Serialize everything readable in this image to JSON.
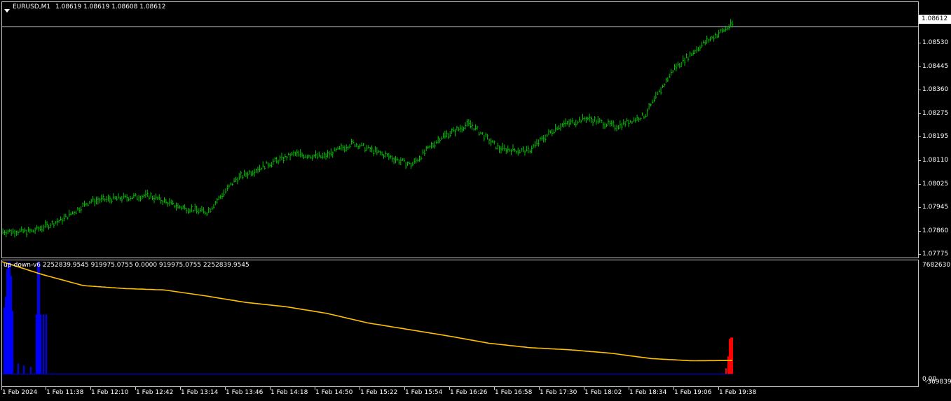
{
  "header": {
    "symbol_label": "EURUSD,M1",
    "ohlc_text": "1.08619 1.08619 1.08608 1.08612",
    "dropdown_icon": "triangle-down-icon"
  },
  "indicator": {
    "label": "up-down-v6 2252839.9545 919975.0755 0.0000 919975.0755 2252839.9545",
    "top_value": "7682630.4",
    "bottom_value": "0.00",
    "bottom_value2": "-369839.5"
  },
  "price_axis": {
    "ticks": [
      "1.08530",
      "1.08445",
      "1.08360",
      "1.08275",
      "1.08195",
      "1.08110",
      "1.08025",
      "1.07945",
      "1.07860",
      "1.07775"
    ],
    "current": "1.08612"
  },
  "time_axis": [
    "1 Feb 2024",
    "1 Feb 11:38",
    "1 Feb 12:10",
    "1 Feb 12:42",
    "1 Feb 13:14",
    "1 Feb 13:46",
    "1 Feb 14:18",
    "1 Feb 14:50",
    "1 Feb 15:22",
    "1 Feb 15:54",
    "1 Feb 16:26",
    "1 Feb 16:58",
    "1 Feb 17:30",
    "1 Feb 18:02",
    "1 Feb 18:34",
    "1 Feb 19:06",
    "1 Feb 19:38"
  ],
  "colors": {
    "bars": "#00c000",
    "yellow_line": "#ffc000",
    "up_hist": "#0000ff",
    "down_hist": "#ff0000",
    "grid": "#c8c8c8",
    "background": "#000000"
  },
  "chart_data": [
    {
      "type": "line",
      "title": "EURUSD,M1",
      "ylim": [
        1.07775,
        1.0865
      ],
      "x": [
        "1 Feb 2024",
        "1 Feb 11:38",
        "1 Feb 12:10",
        "1 Feb 12:42",
        "1 Feb 13:14",
        "1 Feb 13:46",
        "1 Feb 14:18",
        "1 Feb 14:50",
        "1 Feb 15:22",
        "1 Feb 15:54",
        "1 Feb 16:26",
        "1 Feb 16:58",
        "1 Feb 17:30",
        "1 Feb 18:02",
        "1 Feb 18:34",
        "1 Feb 19:06",
        "1 Feb 19:38"
      ],
      "series": [
        {
          "values": [
            1.0787,
            1.0787,
            1.0791,
            1.0798,
            1.0799,
            1.08,
            1.0796,
            1.0794,
            1.0806,
            1.0811,
            1.0815,
            1.0814,
            1.0819,
            1.0815,
            1.0811,
            1.0821,
            1.0826,
            1.0817,
            1.0816,
            1.0825,
            1.0828,
            1.0825,
            1.0829,
            1.0846,
            1.0855,
            1.0862
          ]
        }
      ]
    },
    {
      "type": "line",
      "title": "up-down-v6",
      "ylim": [
        -369839.5,
        7682630.4
      ],
      "series": [
        {
          "values": [
            7682630.4,
            6800000,
            6050000,
            5850000,
            5750000,
            5350000,
            4900000,
            4600000,
            4150000,
            3500000,
            3050000,
            2600000,
            2100000,
            1800000,
            1650000,
            1420000,
            1050000,
            900000,
            919975.0755
          ]
        }
      ]
    }
  ]
}
